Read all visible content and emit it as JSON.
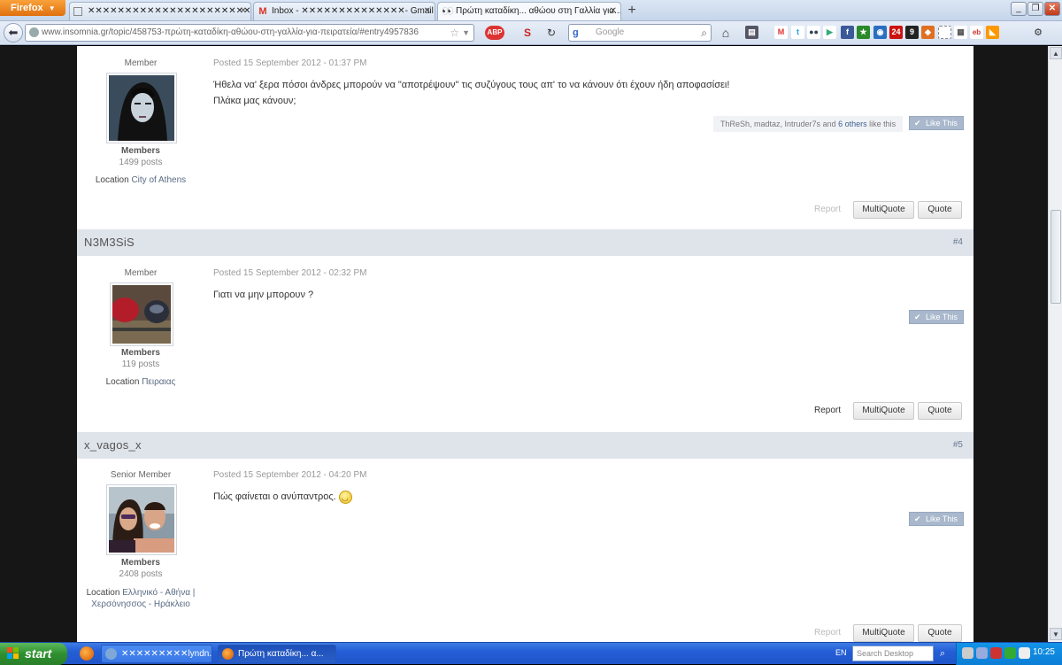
{
  "browser": {
    "menu_label": "Firefox",
    "tabs": [
      {
        "title": "✕✕✕✕✕✕✕✕✕✕✕✕✕✕✕✕✕✕✕✕✕✕✕✕✕✕✕✕..."
      },
      {
        "title": "Inbox - ✕✕✕✕✕✕✕✕✕✕✕✕✕✕- Gmail"
      },
      {
        "title": "Πρώτη καταδίκη... αθώου στη Γαλλία για..."
      }
    ],
    "new_tab": "+",
    "url": "www.insomnia.gr/topic/458753-πρώτη-καταδίκη-αθώου-στη-γαλλία-για-πειρατεία/#entry4957836",
    "search_placeholder": "Google"
  },
  "posts": [
    {
      "rank": "Member",
      "posted": "Posted 15 September 2012 - 01:37 PM",
      "body_line1": "Ήθελα να' ξερα πόσοι άνδρες μπορούν να \"αποτρέψουν\" τις συζύγους τους απ' το να κάνουν ότι έχουν ήδη αποφασίσει!",
      "body_line2": "Πλάκα μας κάνουν;",
      "group": "Members",
      "post_count": "1499 posts",
      "location_label": "Location",
      "location_value": "City of Athens",
      "likes_names": "ThReSh, madtaz, Intruder7s",
      "likes_and": "and",
      "likes_others": "6 others",
      "likes_suffix": "like this",
      "like_button": "Like This",
      "report": "Report",
      "multiquote": "MultiQuote",
      "quote": "Quote"
    },
    {
      "author": "N3M3SiS",
      "number": "#4",
      "rank": "Member",
      "posted": "Posted 15 September 2012 - 02:32 PM",
      "body": "Γιατι να μην μπορουν ?",
      "group": "Members",
      "post_count": "119 posts",
      "location_label": "Location",
      "location_value": "Πειραιας",
      "like_button": "Like This",
      "report": "Report",
      "multiquote": "MultiQuote",
      "quote": "Quote"
    },
    {
      "author": "x_vagos_x",
      "number": "#5",
      "rank": "Senior Member",
      "posted": "Posted 15 September 2012 - 04:20 PM",
      "body": "Πώς φαίνεται ο ανύπαντρος.",
      "group": "Members",
      "post_count": "2408 posts",
      "location_label": "Location",
      "location_value_line1": "Ελληνικό - Αθήνα |",
      "location_value_line2": "Χερσόνησσος - Ηράκλειο",
      "like_button": "Like This",
      "report": "Report",
      "multiquote": "MultiQuote",
      "quote": "Quote"
    }
  ],
  "taskbar": {
    "start": "start",
    "tasks": [
      {
        "title": "✕✕✕✕✕✕✕✕✕lyndn..."
      },
      {
        "title": "Πρώτη καταδίκη... α..."
      }
    ],
    "lang": "EN",
    "search_placeholder": "Search Desktop",
    "clock": "10:25"
  },
  "colors": {
    "post_header_bg": "#dfe3ea",
    "like_button_bg": "#a9b8cc",
    "taskbar_blue": "#245ed6",
    "start_green": "#2f8f2f",
    "firefox_orange": "#e0710f"
  }
}
